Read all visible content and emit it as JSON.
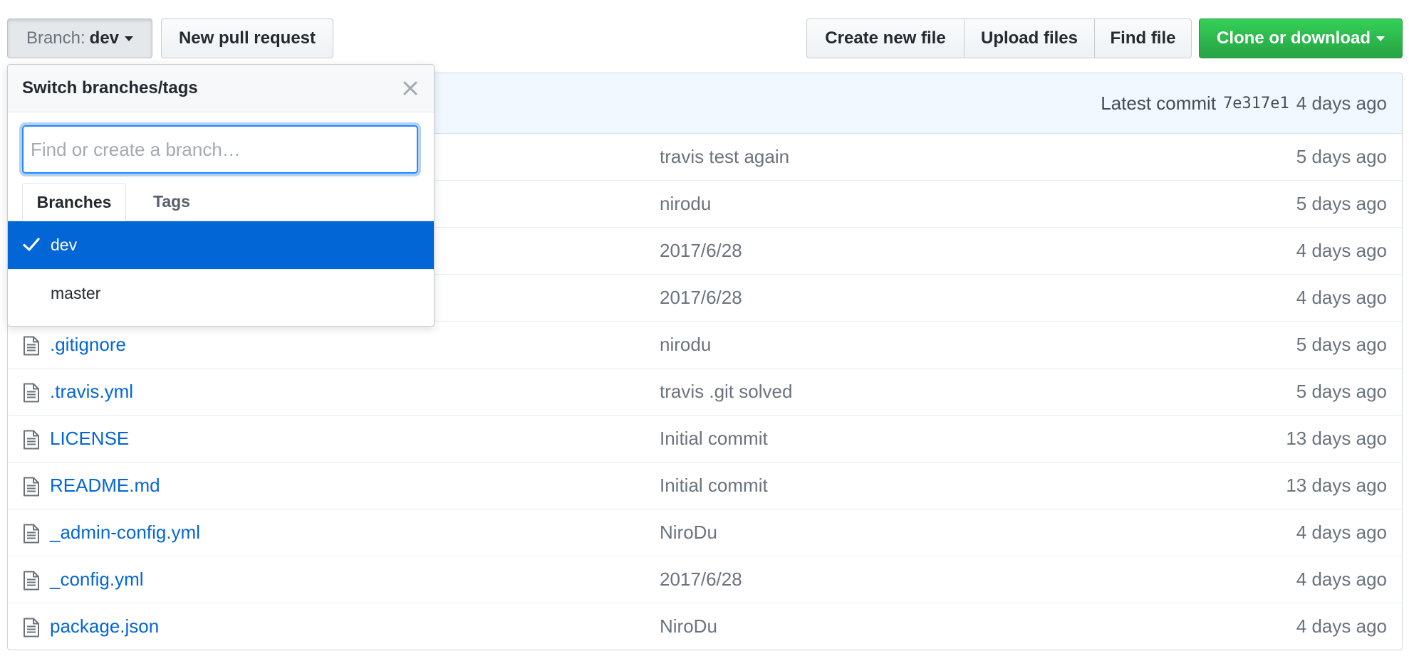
{
  "toolbar": {
    "branch_prefix": "Branch:",
    "branch_name": "dev",
    "new_pull_request": "New pull request",
    "create_new_file": "Create new file",
    "upload_files": "Upload files",
    "find_file": "Find file",
    "clone_or_download": "Clone or download"
  },
  "commit_bar": {
    "label": "Latest commit",
    "sha": "7e317e1",
    "age": "4 days ago"
  },
  "files": [
    {
      "name": "",
      "message": "travis test again",
      "age": "5 days ago"
    },
    {
      "name": "",
      "message": "nirodu",
      "age": "5 days ago"
    },
    {
      "name": "",
      "message": "2017/6/28",
      "age": "4 days ago"
    },
    {
      "name": "",
      "message": "2017/6/28",
      "age": "4 days ago"
    },
    {
      "name": ".gitignore",
      "message": "nirodu",
      "age": "5 days ago"
    },
    {
      "name": ".travis.yml",
      "message": "travis .git solved",
      "age": "5 days ago"
    },
    {
      "name": "LICENSE",
      "message": "Initial commit",
      "age": "13 days ago"
    },
    {
      "name": "README.md",
      "message": "Initial commit",
      "age": "13 days ago"
    },
    {
      "name": "_admin-config.yml",
      "message": "NiroDu",
      "age": "4 days ago"
    },
    {
      "name": "_config.yml",
      "message": "2017/6/28",
      "age": "4 days ago"
    },
    {
      "name": "package.json",
      "message": "NiroDu",
      "age": "4 days ago"
    }
  ],
  "dropdown": {
    "title": "Switch branches/tags",
    "filter_placeholder": "Find or create a branch…",
    "filter_value": "",
    "tabs": {
      "branches": "Branches",
      "tags": "Tags"
    },
    "branches": [
      {
        "name": "dev",
        "selected": true
      },
      {
        "name": "master",
        "selected": false
      }
    ]
  },
  "colors": {
    "accent": "#0366d6",
    "clone_green": "#28a745",
    "commit_bar_bg": "#f1f8ff",
    "link": "#0366d6",
    "muted": "#6a737d"
  },
  "icons": {
    "file": "file-icon",
    "close": "close-icon",
    "check": "check-icon",
    "caret": "caret-down-icon"
  }
}
